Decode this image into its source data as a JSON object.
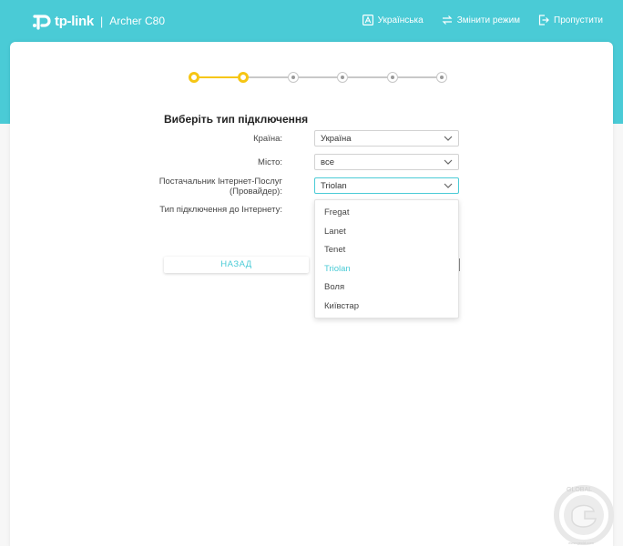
{
  "header": {
    "brand": "tp-link",
    "separator": "|",
    "model": "Archer C80",
    "language_label": "Українська",
    "change_mode_label": "Змінити режим",
    "skip_label": "Пропустити"
  },
  "stepper": {
    "total_steps": 6,
    "current_step": 2,
    "active_color": "#f6c614",
    "inactive_color": "#c8c8c8"
  },
  "form": {
    "title": "Виберіть тип підключення",
    "country_label": "Країна:",
    "country_value": "Україна",
    "city_label": "Місто:",
    "city_value": "все",
    "isp_label_line1": "Постачальник Інтернет-Послуг",
    "isp_label_line2": "(Провайдер):",
    "isp_value": "Triolan",
    "connection_type_label": "Тип підключення до Інтернету:"
  },
  "isp_dropdown": {
    "options": [
      "Fregat",
      "Lanet",
      "Tenet",
      "Triolan",
      "Воля",
      "Київстар"
    ],
    "selected": "Triolan"
  },
  "buttons": {
    "back_label": "НАЗАД"
  },
  "watermark": {
    "text_top": "GLOBAL",
    "text_site": "www.gecid.com"
  },
  "colors": {
    "accent": "#4acbd6",
    "step_active": "#f6c614"
  }
}
